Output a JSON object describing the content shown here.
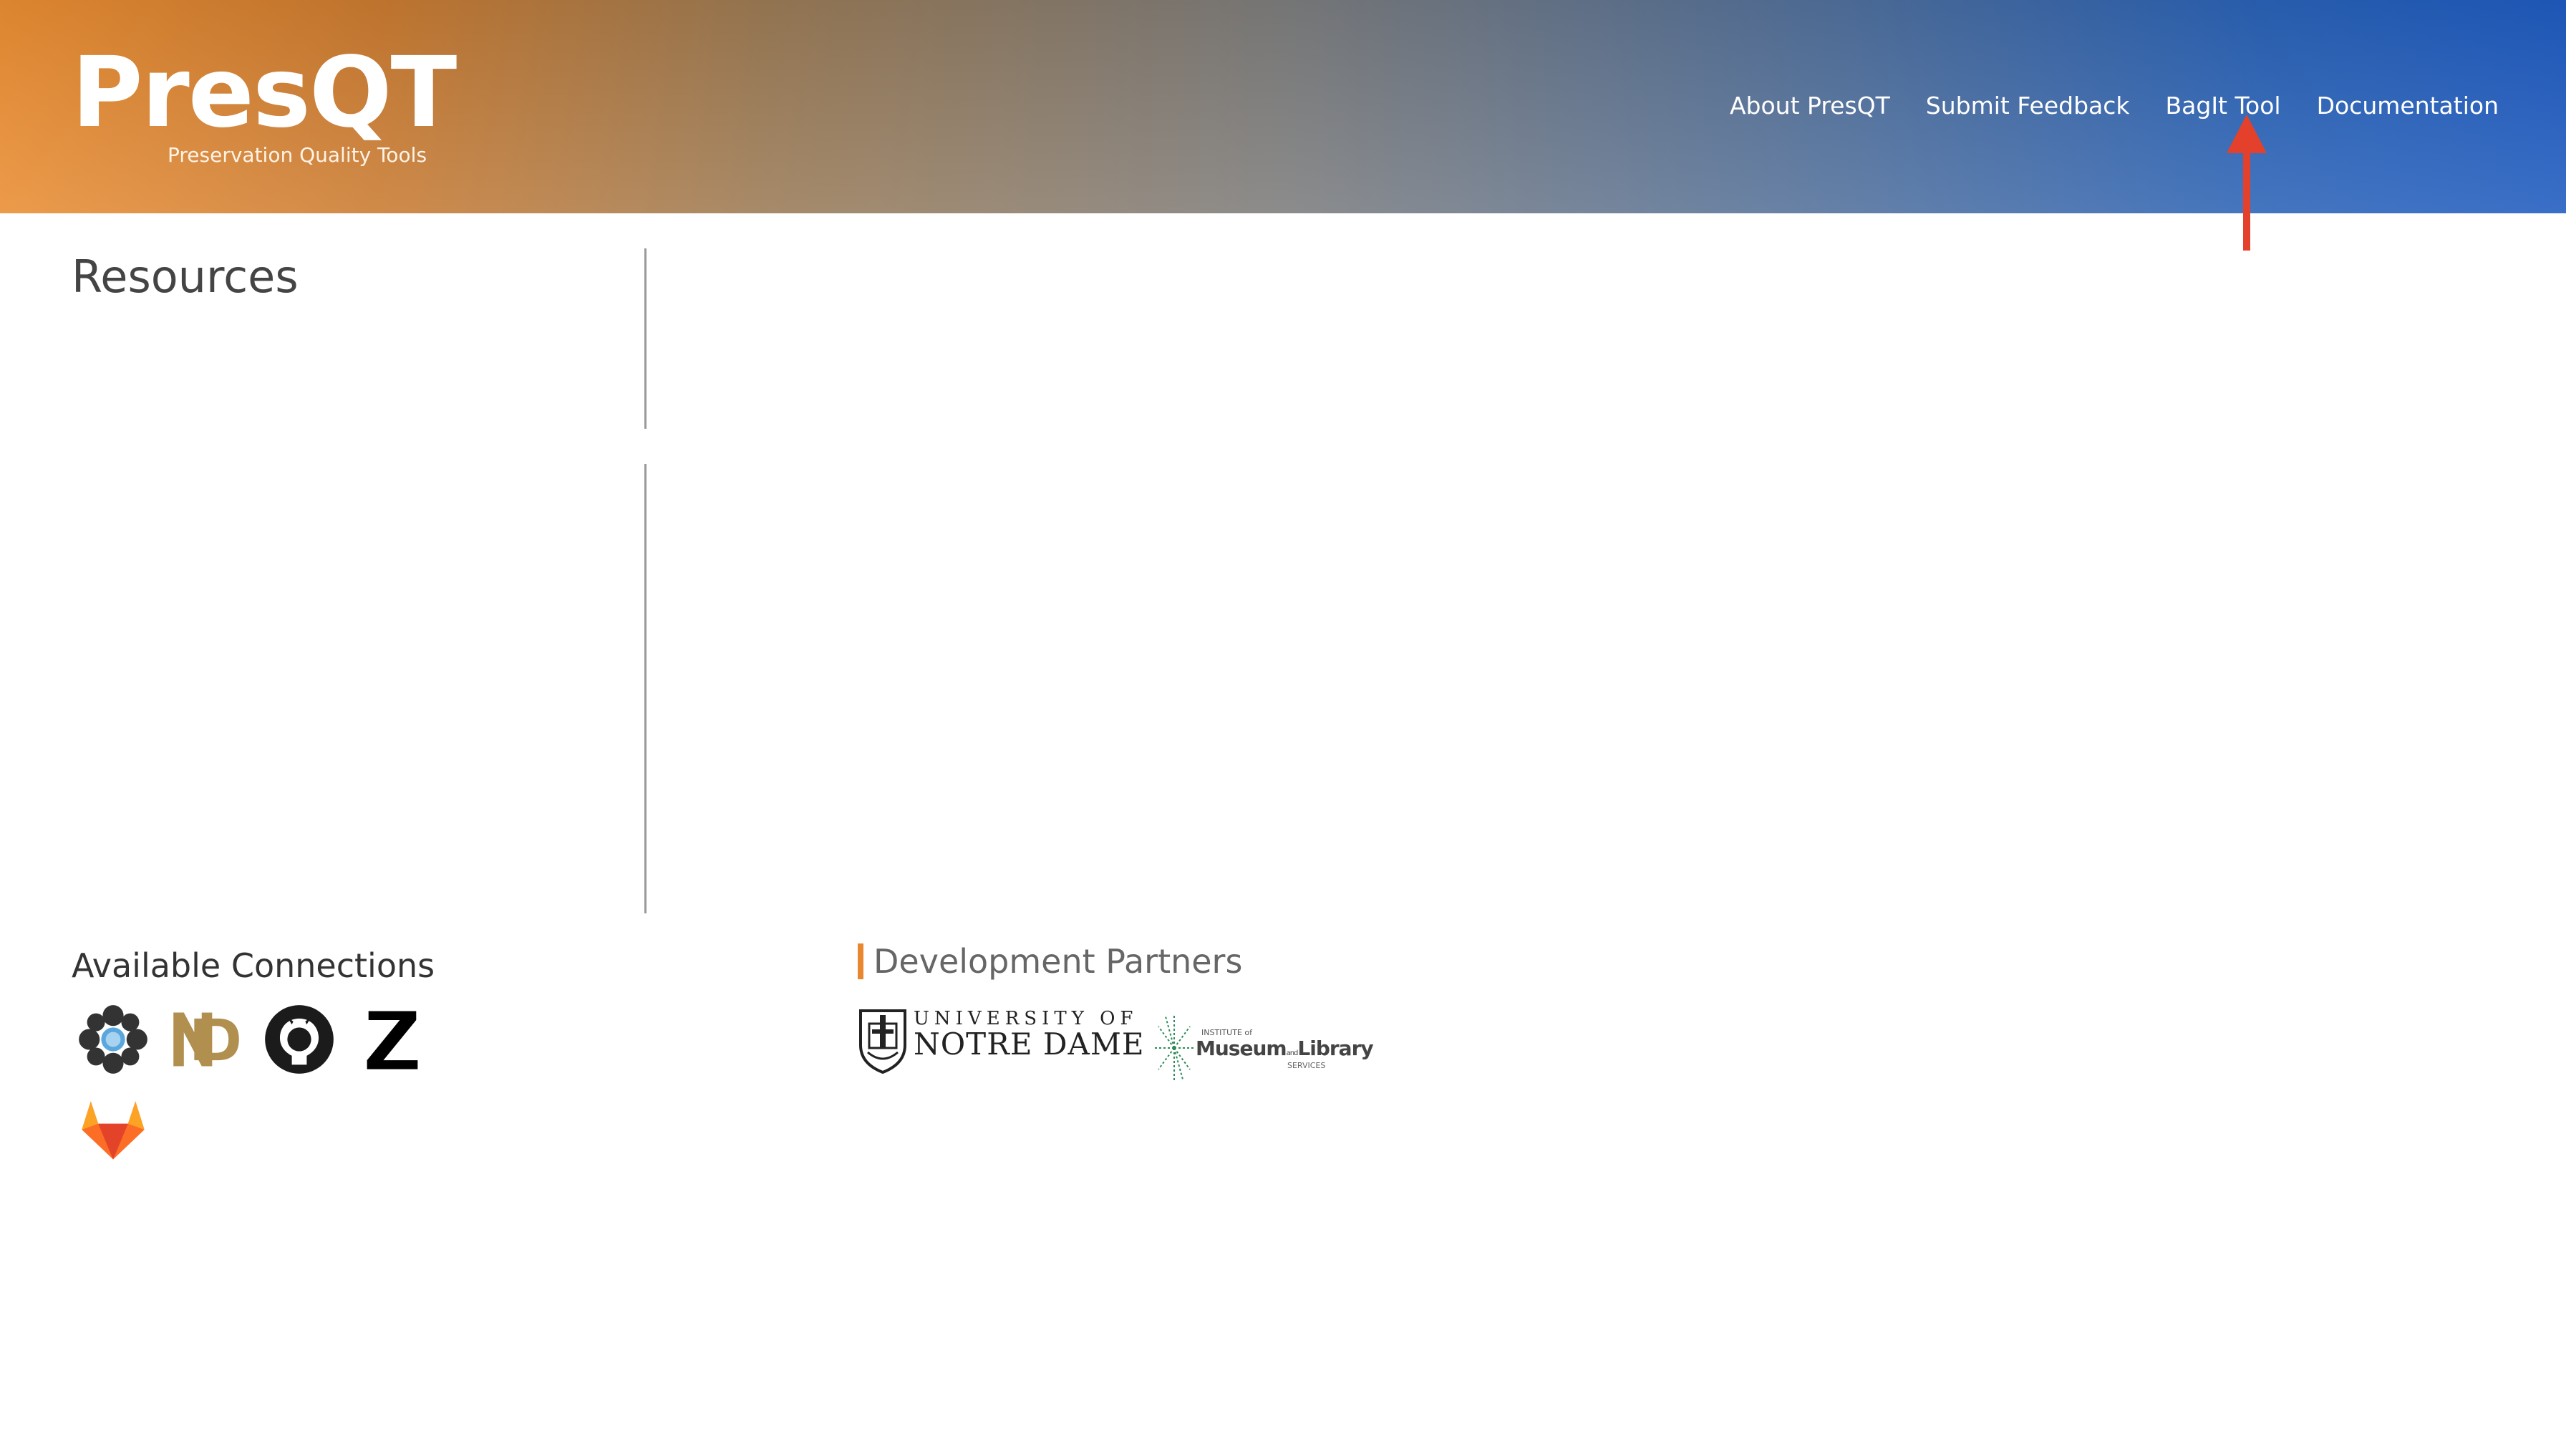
{
  "header": {
    "logo_title": "PresQT",
    "logo_subtitle": "Preservation Quality Tools",
    "nav": [
      {
        "label": "About PresQT"
      },
      {
        "label": "Submit Feedback"
      },
      {
        "label": "BagIt Tool"
      },
      {
        "label": "Documentation"
      }
    ],
    "annotation_arrow_color": "#e3412b"
  },
  "main": {
    "resources_title": "Resources"
  },
  "footer": {
    "connections_title": "Available Connections",
    "connections": [
      {
        "icon": "osf-icon"
      },
      {
        "icon": "curatend-icon"
      },
      {
        "icon": "github-icon"
      },
      {
        "icon": "zenodo-icon"
      },
      {
        "icon": "gitlab-icon"
      }
    ],
    "partners_title": "Development Partners",
    "partners": {
      "notre_dame": {
        "line1": "UNIVERSITY OF",
        "line2": "NOTRE DAME"
      },
      "imls": {
        "small": "INSTITUTE of",
        "main_a": "Museum",
        "main_and": "and",
        "main_b": "Library",
        "bottom": "SERVICES"
      }
    },
    "accent_color": "#e8872d"
  }
}
